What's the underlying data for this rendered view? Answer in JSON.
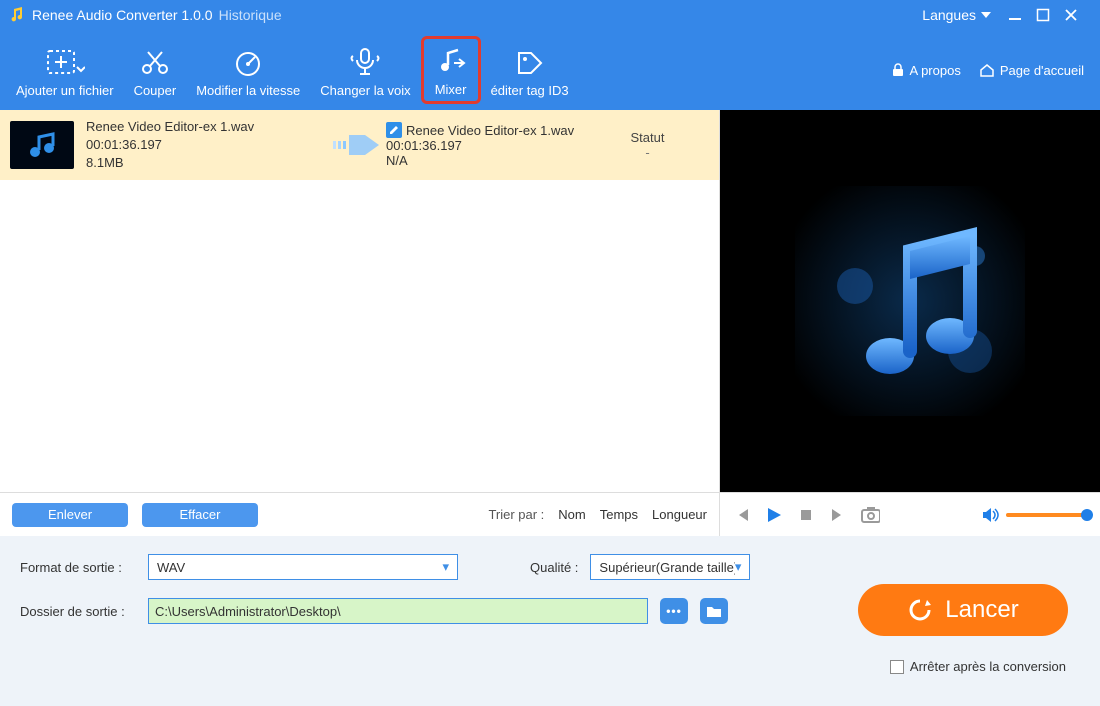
{
  "title": {
    "app": "Renee Audio Converter 1.0.0",
    "history": "Historique"
  },
  "window": {
    "languages": "Langues"
  },
  "toolbar": {
    "add": "Ajouter un fichier",
    "cut": "Couper",
    "speed": "Modifier la vitesse",
    "voice": "Changer la voix",
    "mixer": "Mixer",
    "id3": "éditer tag ID3",
    "about": "A propos",
    "home": "Page d'accueil"
  },
  "file": {
    "src_name": "Renee Video Editor-ex 1.wav",
    "src_duration": "00:01:36.197",
    "src_size": "8.1MB",
    "dst_name": "Renee Video Editor-ex 1.wav",
    "dst_duration": "00:01:36.197",
    "dst_size": "N/A",
    "status_label": "Statut",
    "status_value": "-"
  },
  "listfoot": {
    "remove": "Enlever",
    "clear": "Effacer",
    "sortby": "Trier par :",
    "name": "Nom",
    "time": "Temps",
    "length": "Longueur"
  },
  "output": {
    "format_label": "Format de sortie :",
    "format_value": "WAV",
    "quality_label": "Qualité :",
    "quality_value": "Supérieur(Grande taille)",
    "folder_label": "Dossier de sortie :",
    "folder_value": "C:\\Users\\Administrator\\Desktop\\"
  },
  "launch": "Lancer",
  "stop_after": "Arrêter après la conversion"
}
